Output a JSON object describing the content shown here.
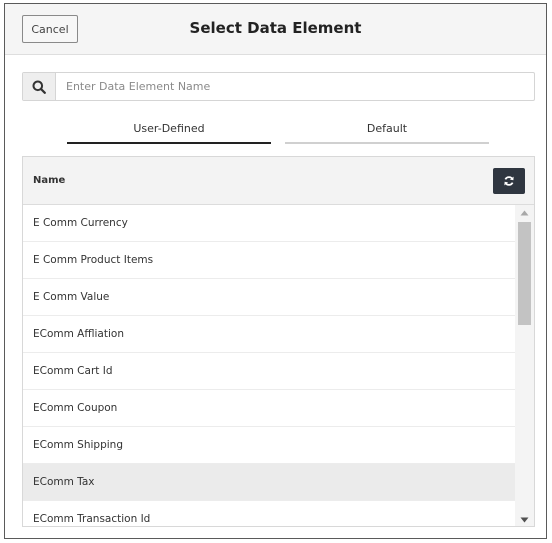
{
  "modal": {
    "title": "Select Data Element",
    "cancel_label": "Cancel"
  },
  "search": {
    "placeholder": "Enter Data Element Name",
    "value": ""
  },
  "tabs": [
    {
      "label": "User-Defined",
      "active": true
    },
    {
      "label": "Default",
      "active": false
    }
  ],
  "table": {
    "column_header": "Name",
    "rows": [
      "E Comm Currency",
      "E Comm Product Items",
      "E Comm Value",
      "EComm Affliation",
      "EComm Cart Id",
      "EComm Coupon",
      "EComm Shipping",
      "EComm Tax",
      "EComm Transaction Id"
    ],
    "selected_row": "EComm Tax"
  },
  "icons": {
    "search": "search-icon",
    "refresh": "refresh-icon",
    "scroll_up": "caret-up-icon",
    "scroll_down": "caret-down-icon"
  },
  "colors": {
    "refresh_button": "#2f3640",
    "selected_row": "#ebebeb",
    "header_bg": "#f5f5f5"
  }
}
